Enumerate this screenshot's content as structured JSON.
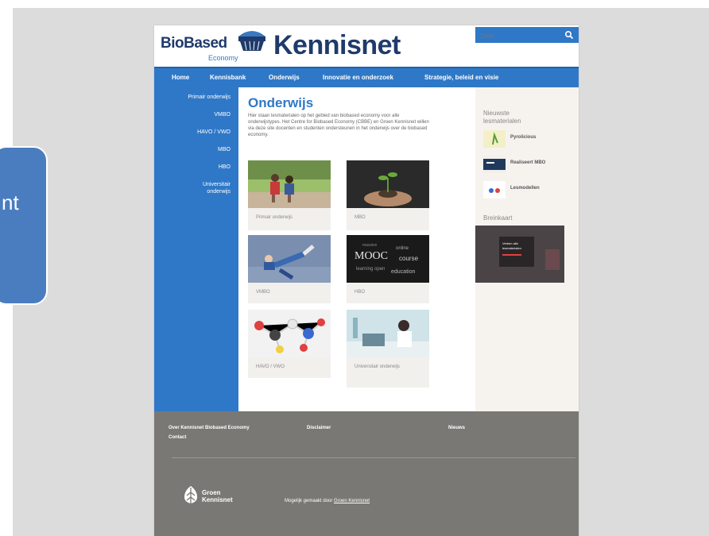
{
  "side_bubble": {
    "text": "nt"
  },
  "header": {
    "logo_bio": "BioBased",
    "logo_eco": "Economy",
    "logo_kennis": "Kennisnet",
    "search_placeholder": "Zoek"
  },
  "nav": {
    "items": [
      "Home",
      "Kennisbank",
      "Onderwijs",
      "Innovatie en onderzoek",
      "Strategie, beleid en visie"
    ]
  },
  "leftnav": {
    "items": [
      "Primair onderwijs",
      "VMBO",
      "HAVO / VWO",
      "MBO",
      "HBO",
      "Universitair onderwijs"
    ]
  },
  "content": {
    "title": "Onderwijs",
    "intro": "Hier staan lesmaterialen op het gebied van biobased economy voor alle onderwijstypes. Het Centre for Biobased Economy (CBBE) en Groen Kennisnet willen via deze site docenten en studenten ondersteunen in het onderwijs over de biobased economy.",
    "tiles": [
      "Primair onderwijs",
      "MBO",
      "VMBO",
      "HBO",
      "HAVO / VWO",
      "Universitair onderwijs"
    ]
  },
  "right": {
    "heading_new": "Nieuwste lesmaterialen",
    "new_items": [
      "Pyrolicious",
      "Realiseert MBO",
      "Lesmodellen"
    ],
    "heading_map": "Breinkaart",
    "map_caption": "Verken alle lesmaterialen"
  },
  "footer": {
    "links": [
      "Over Kennisnet Biobased Economy",
      "Contact",
      "Disclaimer",
      "Nieuws"
    ],
    "logo_text": "Groen Kennisnet",
    "credit_prefix": "Mogelijk gemaakt door",
    "credit_link": "Groen Kennisnet"
  },
  "colors": {
    "brand_blue": "#2f78c7",
    "navy": "#1f3a6b",
    "footer_gray": "#7a7874"
  }
}
